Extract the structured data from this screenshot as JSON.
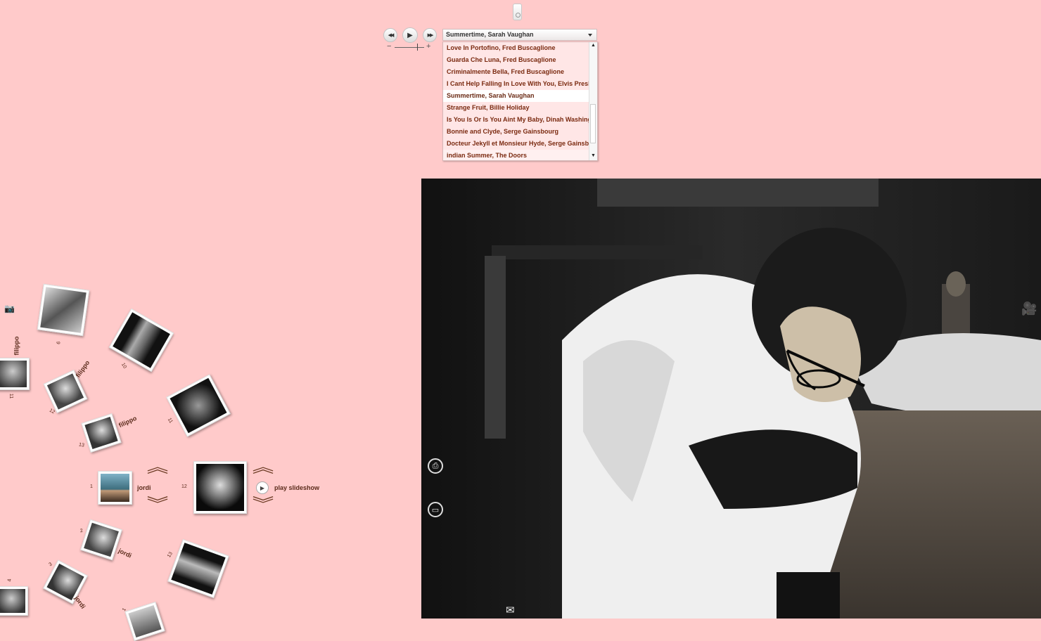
{
  "player": {
    "rewind_icon": "◀◀",
    "play_icon": "▶",
    "forward_icon": "▶▶",
    "volume_minus": "−",
    "volume_plus": "+",
    "volume_level": 0.78,
    "selected_track": "Summertime, Sarah Vaughan",
    "tracks": [
      "Love In Portofino, Fred Buscaglione",
      "Guarda Che Luna, Fred Buscaglione",
      "Criminalmente Bella, Fred Buscaglione",
      "I Cant Help Falling In Love With You, Elvis Presl",
      "Summertime, Sarah Vaughan",
      "Strange Fruit, Billie Holiday",
      "Is You Is Or Is You Aint My Baby, Dinah Washing",
      "Bonnie and Clyde, Serge Gainsbourg",
      "Docteur Jekyll et Monsieur Hyde, Serge Gainsb",
      "indian Summer, The Doors"
    ]
  },
  "carousel": {
    "left_wheel": [
      {
        "label": "filippo",
        "num": "11"
      },
      {
        "label": "filippo",
        "num": "12"
      },
      {
        "label": "filippo",
        "num": "13"
      },
      {
        "label": "",
        "num": "9"
      },
      {
        "label": "",
        "num": "10"
      },
      {
        "label": "",
        "num": "11"
      }
    ],
    "current_user": {
      "num": "1",
      "label": "jordi"
    },
    "current_photo": {
      "num": "12"
    },
    "play_slideshow": "play slideshow",
    "lower_wheel": [
      {
        "label": "jordi",
        "num": "2"
      },
      {
        "label": "jordi",
        "num": "3"
      },
      {
        "label": "",
        "num": "4"
      },
      {
        "label": "",
        "num": "13"
      },
      {
        "label": "",
        "num": "1"
      }
    ]
  },
  "icons": {
    "camera": "camera-icon",
    "video": "video-camera-icon",
    "print": "print-icon",
    "mail": "mail-icon",
    "gallery": "gallery-icon"
  }
}
